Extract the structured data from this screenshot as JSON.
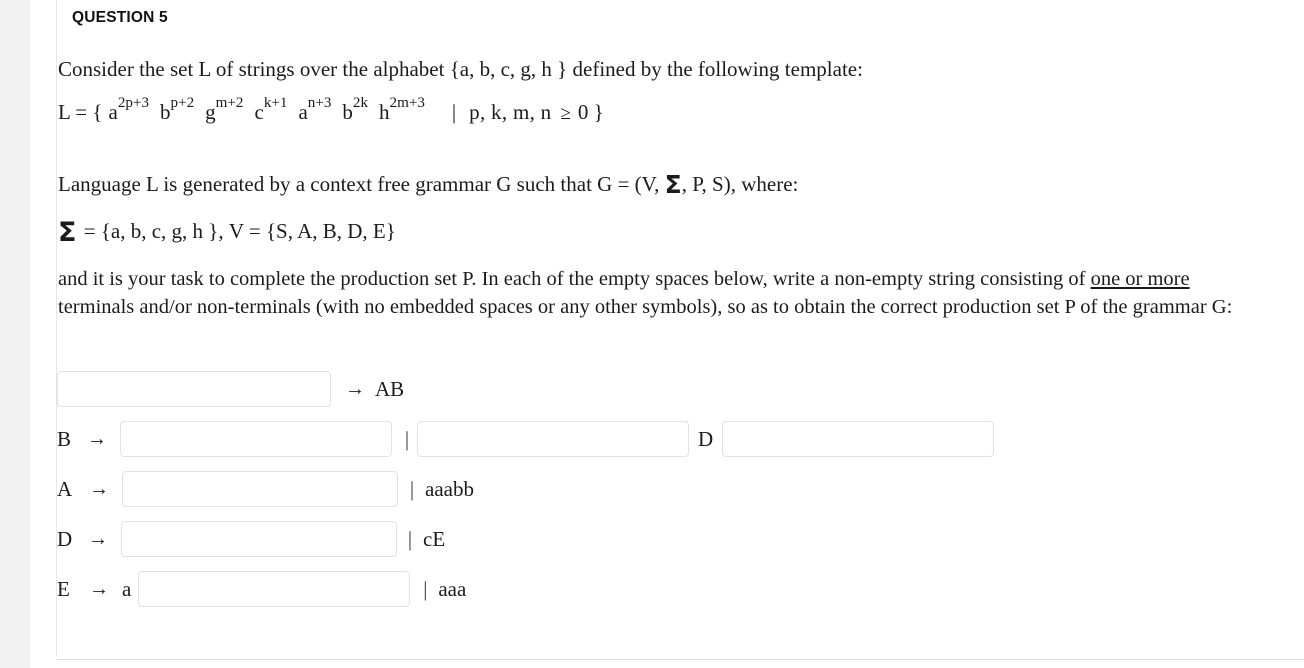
{
  "question": {
    "title": "QUESTION 5"
  },
  "intro": {
    "line1_part1": "Consider the set  L  of strings over the alphabet {a, b, c, g, h } defined by the following template:",
    "template": {
      "lhs": "L = {",
      "terms": [
        {
          "base": "a",
          "sup": "2p+3"
        },
        {
          "base": "b",
          "sup": "p+2"
        },
        {
          "base": "g",
          "sup": "m+2"
        },
        {
          "base": "c",
          "sup": "k+1"
        },
        {
          "base": "a",
          "sup": "n+3"
        },
        {
          "base": "b",
          "sup": "2k"
        },
        {
          "base": "h",
          "sup": "2m+3"
        }
      ],
      "separator": "|",
      "vars": "p, k, m, n",
      "relation": "≥",
      "bound": "0 }"
    }
  },
  "grammar": {
    "line_generated_prefix": "Language L is generated by a context free grammar G such that  G = (V, ",
    "line_generated_sigma": "Σ",
    "line_generated_suffix": ", P, S),  where:",
    "sigma_symbol": "Σ",
    "sigma_def": " = {a, b, c, g, h },   V = {S, A, B, D, E}"
  },
  "task": {
    "part1": "and it is your task to complete the production set P.   In  each of the empty spaces below, write a non-empty string consisting of ",
    "emphasis": "one or more",
    "part2": " terminals and/or non-terminals (with no embedded spaces or any other symbols), so as to obtain the correct production set P of the grammar G:"
  },
  "productions": [
    {
      "id": "rule-s",
      "lhs": "",
      "arrow": "",
      "blank1_value": "",
      "blank1_placeholder": "",
      "after_blank_arrow": "→",
      "after_blank_text": "AB",
      "pipe": "",
      "alt1": "",
      "mid_label": "",
      "blank2_value": "",
      "blank3_value": ""
    },
    {
      "id": "rule-b",
      "lhs": "B",
      "arrow": "→",
      "blank1_value": "",
      "pipe": "|",
      "blank2_value": "",
      "mid_label": "D",
      "blank3_value": ""
    },
    {
      "id": "rule-a",
      "lhs": "A",
      "arrow": "→",
      "blank1_value": "",
      "pipe": "|",
      "alt1": "aaabb"
    },
    {
      "id": "rule-d",
      "lhs": "D",
      "arrow": "→",
      "blank1_value": "",
      "pipe": "|",
      "alt1": "cE"
    },
    {
      "id": "rule-e",
      "lhs": "E",
      "arrow": "→",
      "prefix_terminal": "a",
      "blank1_value": "",
      "pipe": "|",
      "alt1": "aaa"
    }
  ]
}
